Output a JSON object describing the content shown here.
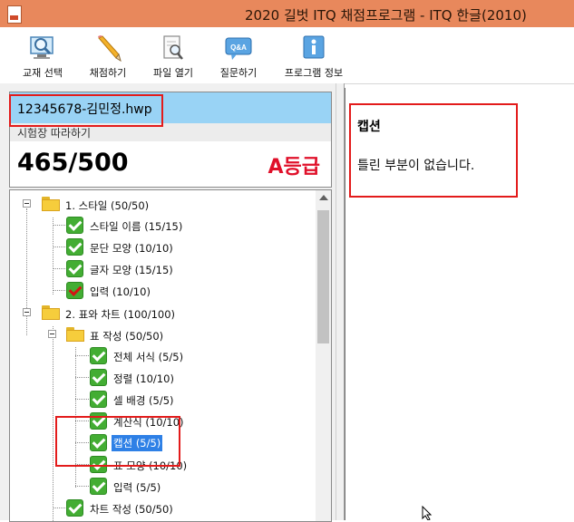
{
  "window": {
    "title": "2020 길벗 ITQ 채점프로그램 - ITQ 한글(2010)"
  },
  "toolbar": {
    "items": [
      {
        "label": "교재 선택",
        "icon": "magnifier-monitor-icon"
      },
      {
        "label": "채점하기",
        "icon": "pencil-icon"
      },
      {
        "label": "파일 열기",
        "icon": "document-search-icon"
      },
      {
        "label": "질문하기",
        "icon": "qa-bubble-icon"
      },
      {
        "label": "프로그램 정보",
        "icon": "info-icon"
      }
    ]
  },
  "score_panel": {
    "filename": "12345678-김민정.hwp",
    "subtitle": "시험장 따라하기",
    "score": "465/500",
    "grade": "A등급"
  },
  "tree": {
    "nodes": [
      {
        "label": "1. 스타일 (50/50)",
        "type": "folder"
      },
      {
        "label": "스타일 이름 (15/15)",
        "type": "check"
      },
      {
        "label": "문단 모양 (10/10)",
        "type": "check"
      },
      {
        "label": "글자 모양 (15/15)",
        "type": "check"
      },
      {
        "label": "입력 (10/10)",
        "type": "check"
      },
      {
        "label": "2. 표와 차트 (100/100)",
        "type": "folder"
      },
      {
        "label": "표 작성 (50/50)",
        "type": "folder"
      },
      {
        "label": "전체 서식 (5/5)",
        "type": "check"
      },
      {
        "label": "정렬 (10/10)",
        "type": "check"
      },
      {
        "label": "셀 배경 (5/5)",
        "type": "check"
      },
      {
        "label": "계산식 (10/10)",
        "type": "check"
      },
      {
        "label": "캡션 (5/5)",
        "type": "check",
        "selected": true
      },
      {
        "label": "표 모양 (10/10)",
        "type": "check"
      },
      {
        "label": "입력 (5/5)",
        "type": "check"
      },
      {
        "label": "차트 작성 (50/50)",
        "type": "check"
      }
    ]
  },
  "detail": {
    "title": "캡션",
    "message": "틀린 부분이 없습니다."
  },
  "colors": {
    "titlebar": "#e8885c",
    "filebar": "#99d3f5",
    "grade": "#e0102a",
    "check": "#43ad33",
    "selection": "#2e80e6",
    "annotation": "#e31b1b"
  }
}
